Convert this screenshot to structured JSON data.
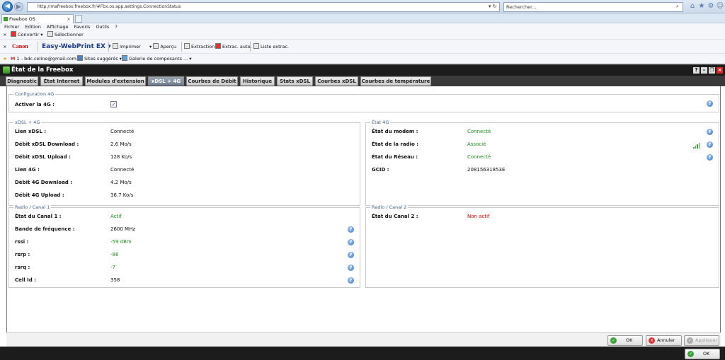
{
  "browser": {
    "url": "http://mafreebox.freebox.fr/#Fbx.os.app.settings.ConnectionStatus",
    "search_placeholder": "Rechercher...",
    "tab_title": "Freebox OS",
    "menu": [
      "Fichier",
      "Edition",
      "Affichage",
      "Favoris",
      "Outils",
      "?"
    ],
    "toolbar1": {
      "convert": "Convertir",
      "select": "Sélectionner"
    },
    "toolbar2": {
      "canon": "Canon",
      "ewp": "Easy-WebPrint EX",
      "print": "Imprimer",
      "preview": "Aperçu",
      "extraction": "Extraction",
      "auto_extract": "Extrac. auto.",
      "extract_list": "Liste extrac."
    },
    "favorites": {
      "mail": "1 - bdc.celine@gmail.com...",
      "suggested": "Sites suggérés",
      "gallery": "Galerie de composants ..."
    }
  },
  "app": {
    "title": "État de la Freebox",
    "tabs": [
      "Diagnostic",
      "État Internet",
      "Modules d'extension",
      "xDSL + 4G",
      "Courbes de Débit",
      "Historique",
      "Stats xDSL",
      "Courbes xDSL",
      "Courbes de température"
    ],
    "active_tab": "xDSL + 4G",
    "config4g": {
      "legend": "Configuration 4G",
      "enable_label": "Activer la 4G :",
      "enabled": true
    },
    "xdsl": {
      "legend": "xDSL + 4G",
      "rows": [
        {
          "label": "Lien xDSL :",
          "value": "Connecté"
        },
        {
          "label": "Débit xDSL Download :",
          "value": "2.6 Mo/s"
        },
        {
          "label": "Débit xDSL Upload :",
          "value": "128 Ko/s"
        },
        {
          "label": "Lien 4G :",
          "value": "Connecté"
        },
        {
          "label": "Débit 4G Download :",
          "value": "4.2 Mo/s"
        },
        {
          "label": "Débit 4G Upload :",
          "value": "36.7 Ko/s"
        }
      ]
    },
    "etat4g": {
      "legend": "État 4G",
      "rows": [
        {
          "label": "État du modem :",
          "value": "Connecté"
        },
        {
          "label": "État de la radio :",
          "value": "Associé"
        },
        {
          "label": "État du Réseau :",
          "value": "Connecté"
        },
        {
          "label": "GCID :",
          "value": "20815631853E"
        }
      ]
    },
    "canal1": {
      "legend": "Radio / Canal 1",
      "rows": [
        {
          "label": "État du Canal 1 :",
          "value": "Actif"
        },
        {
          "label": "Bande de fréquence :",
          "value": "2600 MHz"
        },
        {
          "label": "rssi :",
          "value": "-59 dBm"
        },
        {
          "label": "rsrp :",
          "value": "-86"
        },
        {
          "label": "rsrq :",
          "value": "-7"
        },
        {
          "label": "Cell Id :",
          "value": "358"
        }
      ]
    },
    "canal2": {
      "legend": "Radio / Canal 2",
      "rows": [
        {
          "label": "État du Canal 2 :",
          "value": "Non actif"
        }
      ]
    },
    "buttons": {
      "ok": "OK",
      "cancel": "Annuler",
      "apply": "Appliquer",
      "outer_ok": "OK"
    }
  },
  "colors": {
    "ok_green": "#1f8a1f",
    "error_red": "#d00000",
    "active_tab": "#7f8b9b",
    "title_bar": "#1c1c1c"
  },
  "icons": {
    "help": "help-icon",
    "signal": "signal-bars-icon"
  }
}
